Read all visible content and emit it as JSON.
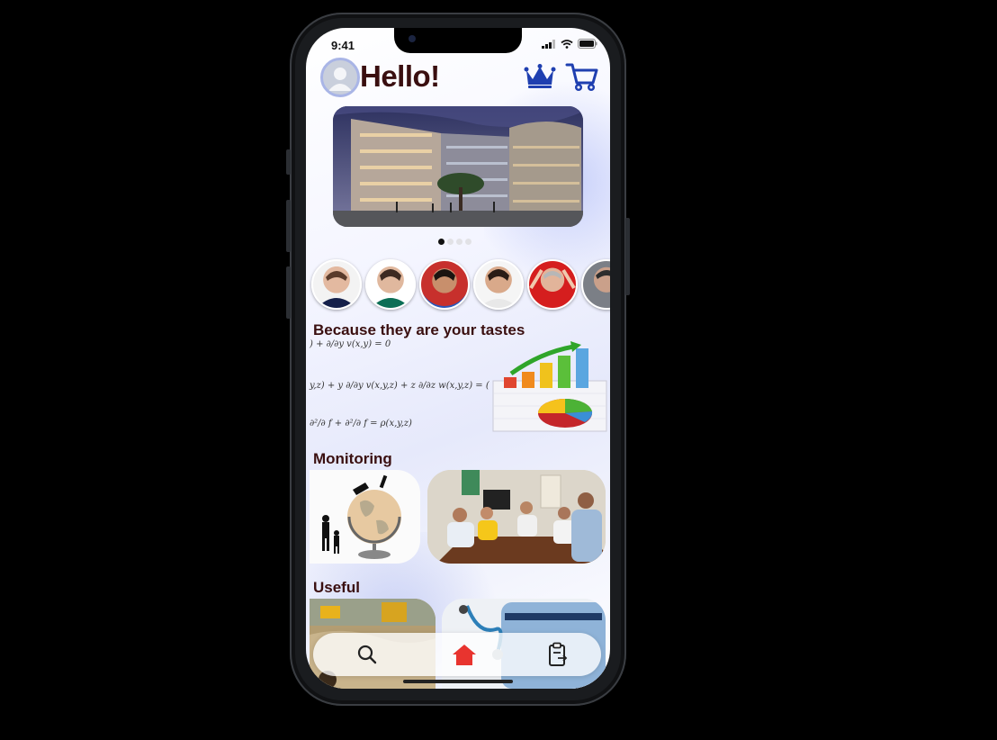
{
  "status_bar": {
    "time": "9:41"
  },
  "header": {
    "greeting": "Hello!",
    "avatar_icon": "user-avatar-icon",
    "crown_icon": "crown-icon",
    "cart_icon": "shopping-cart-icon"
  },
  "carousel": {
    "slide_count": 4,
    "active_index": 0
  },
  "stories": {
    "count": 6
  },
  "sections": {
    "tastes_title": "Because they are your tastes",
    "monitoring_title": "Monitoring",
    "useful_title": "Useful"
  },
  "equations": {
    "eq1": ") + ∂/∂y v(x,y) = 0",
    "eq2": "y,z) + y ∂/∂y v(x,y,z) + z ∂/∂z w(x,y,z) = (",
    "eq3": "∂²/∂ f + ∂²/∂ f = ρ(x,y,z)"
  },
  "bottom_nav": {
    "items": [
      {
        "icon": "search-icon"
      },
      {
        "icon": "home-icon",
        "active": true
      },
      {
        "icon": "clipboard-icon"
      }
    ]
  },
  "colors": {
    "title_text": "#3a0f10",
    "accent_blue": "#1f3fb0",
    "home_active": "#e8342f"
  }
}
